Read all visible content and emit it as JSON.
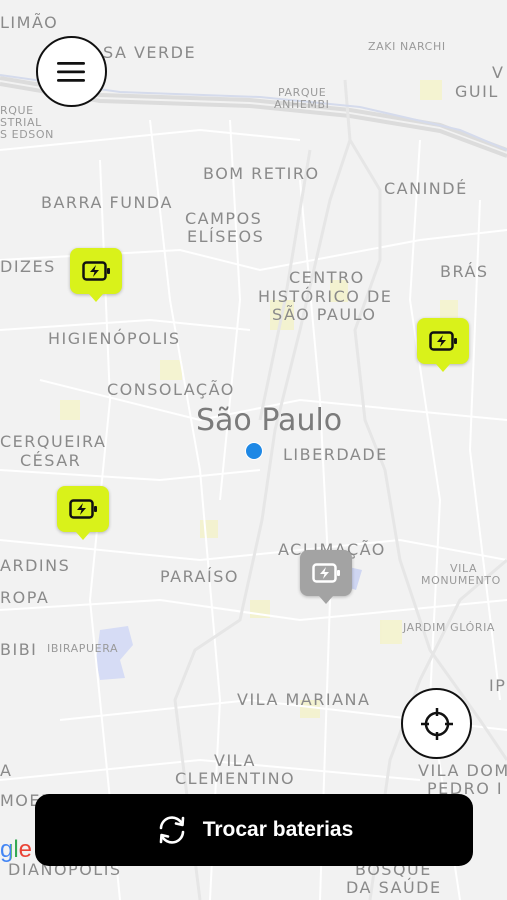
{
  "map": {
    "city_label": "São Paulo",
    "labels": {
      "limao": "LIMÃO",
      "casa_verde": "SA VERDE",
      "zaki_narchi": "ZAKI NARCHI",
      "vila_guilherme_1": "V",
      "vila_guilherme_2": "GUIL",
      "parque_anhembi_1": "PARQUE",
      "parque_anhembi_2": "ANHEMBI",
      "parque_edson_1": "RQUE",
      "parque_edson_2": "STRIAL",
      "parque_edson_3": "S EDSON",
      "bom_retiro": "BOM RETIRO",
      "caninde": "CANINDÉ",
      "barra_funda": "BARRA FUNDA",
      "campos_eliseos_1": "CAMPOS",
      "campos_eliseos_2": "ELÍSEOS",
      "perdizes": "DIZES",
      "bras": "BRÁS",
      "centro_1": "CENTRO",
      "centro_2": "HISTÓRICO DE",
      "centro_3": "SÃO PAULO",
      "higienopolis": "HIGIENÓPOLIS",
      "consolacao": "CONSOLAÇÃO",
      "cerqueira_1": "CERQUEIRA",
      "cerqueira_2": "CÉSAR",
      "liberdade": "LIBERDADE",
      "aclimacao": "ACLIMAÇÃO",
      "jardins": "ARDINS",
      "europa": "ROPA",
      "paraiso": "PARAÍSO",
      "vila_monumento_1": "VILA",
      "vila_monumento_2": "MONUMENTO",
      "ibirapuera": "IBIRAPUERA",
      "moema_bibi": "BIBI",
      "jardim_gloria": "JARDIM GLÓRIA",
      "ipiranga": "IP",
      "vila_mariana": "VILA MARIANA",
      "vila_clementino_1": "VILA",
      "vila_clementino_2": "CLEMENTINO",
      "vila_dom_pedro_1": "VILA DOM",
      "vila_dom_pedro_2": "PEDRO I",
      "vila_a": "A",
      "moema": "MOEM",
      "indianopolis": "DIANÓPOLIS",
      "bosque_1": "BOSQUE",
      "bosque_2": "DA SAÚDE"
    },
    "station_pins": [
      {
        "status": "available",
        "color": "#d9f21a",
        "icon": "battery-charging-icon"
      },
      {
        "status": "available",
        "color": "#d9f21a",
        "icon": "battery-charging-icon"
      },
      {
        "status": "available",
        "color": "#d9f21a",
        "icon": "battery-charging-icon"
      },
      {
        "status": "unavailable",
        "color": "#a3a3a3",
        "icon": "battery-charging-icon"
      }
    ],
    "user_location_color": "#1e88e5"
  },
  "controls": {
    "menu_icon": "hamburger-menu-icon",
    "locate_icon": "crosshair-icon"
  },
  "action_button": {
    "label": "Trocar baterias",
    "icon": "swap-refresh-icon",
    "background": "#000000"
  },
  "attribution": {
    "text": "gle"
  }
}
